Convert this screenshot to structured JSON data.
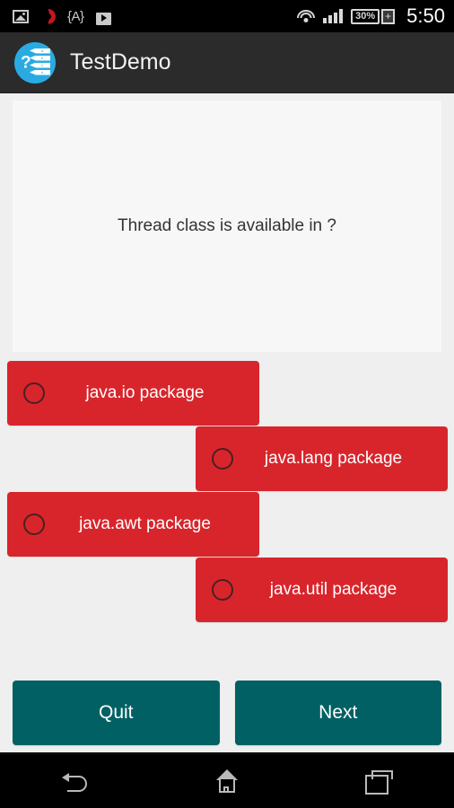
{
  "status_bar": {
    "left_icons": [
      "gallery-icon",
      "opera-icon",
      "font-size-icon",
      "play-store-icon"
    ],
    "font_icon_label": "{A}",
    "right_icons": [
      "wifi-icon",
      "signal-icon"
    ],
    "battery_percent": "30%",
    "battery_charging_glyph": "+",
    "time": "5:50"
  },
  "action_bar": {
    "app_icon": "quiz-app-icon",
    "title": "TestDemo",
    "icon_question_glyph": "?",
    "icon_rows": [
      "a",
      "b",
      "c",
      "d"
    ]
  },
  "question": {
    "text": "Thread class is available in ?"
  },
  "options": [
    {
      "label": "java.io package",
      "align": "left",
      "selected": false
    },
    {
      "label": "java.lang package",
      "align": "right",
      "selected": false
    },
    {
      "label": "java.awt package",
      "align": "left",
      "selected": false
    },
    {
      "label": "java.util package",
      "align": "right",
      "selected": false
    }
  ],
  "footer": {
    "quit_label": "Quit",
    "next_label": "Next"
  },
  "nav_bar": {
    "back": "back-icon",
    "home": "home-icon",
    "recents": "recents-icon"
  },
  "colors": {
    "option_red": "#d8252c",
    "button_teal": "#016063",
    "app_icon_blue": "#29abe2",
    "action_bar": "#2b2b2b",
    "page_background": "#efefef",
    "panel_background": "#f7f7f7"
  }
}
